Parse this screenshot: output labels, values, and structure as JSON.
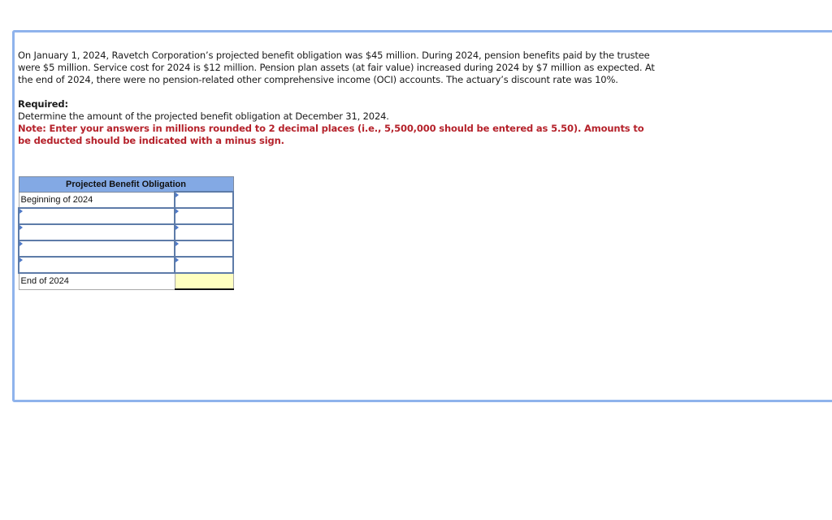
{
  "problem": {
    "paragraph": "On January 1, 2024, Ravetch Corporation’s projected benefit obligation was $45 million. During 2024, pension benefits paid by the trustee were $5 million. Service cost for 2024 is $12 million. Pension plan assets (at fair value) increased during 2024 by $7 million as expected. At the end of 2024, there were no pension-related other comprehensive income (OCI) accounts. The actuary’s discount rate was 10%.",
    "required_label": "Required:",
    "required_text": "Determine the amount of the projected benefit obligation at December 31, 2024.",
    "note": "Note: Enter your answers in millions rounded to 2 decimal places (i.e., 5,500,000 should be entered as 5.50). Amounts to be deducted should be indicated with a minus sign."
  },
  "table": {
    "header": "Projected Benefit Obligation",
    "rows": [
      {
        "label": "Beginning of 2024",
        "label_editable": false,
        "value": ""
      },
      {
        "label": "",
        "label_editable": true,
        "value": ""
      },
      {
        "label": "",
        "label_editable": true,
        "value": ""
      },
      {
        "label": "",
        "label_editable": true,
        "value": ""
      },
      {
        "label": "",
        "label_editable": true,
        "value": ""
      }
    ],
    "total_row": {
      "label": "End of 2024",
      "value": ""
    }
  },
  "colors": {
    "accent_border": "#8fb3ec",
    "header_bg": "#83a9e4",
    "note_red": "#b5222b",
    "total_bg": "#ffffc0"
  }
}
